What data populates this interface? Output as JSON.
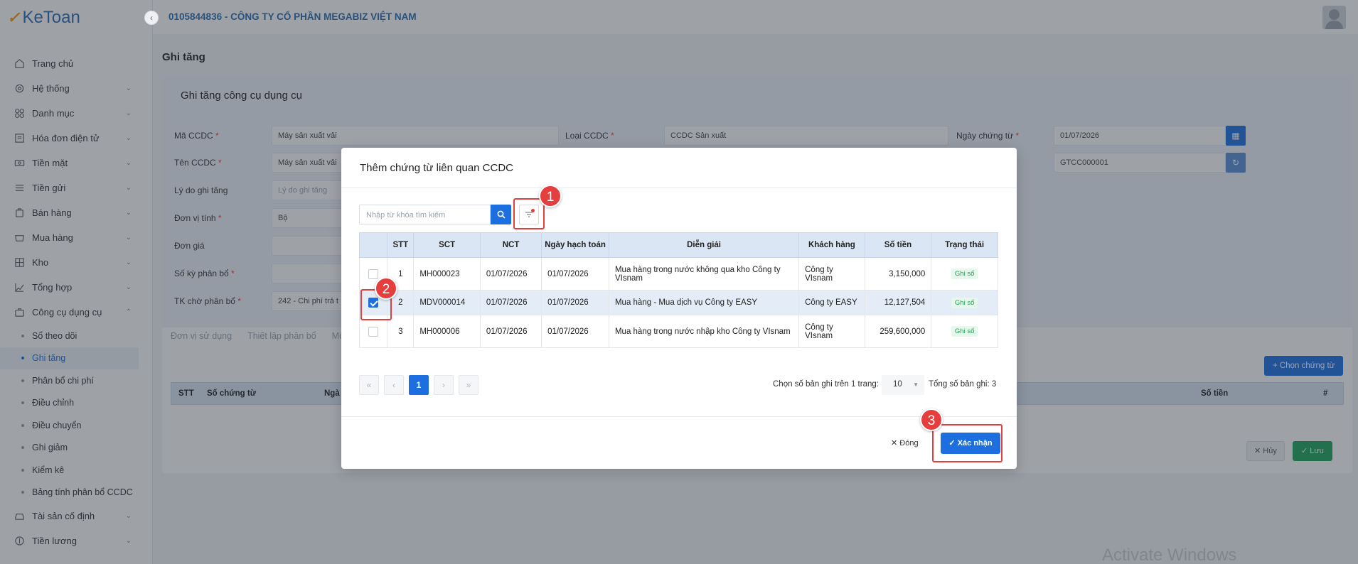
{
  "app": {
    "logo_text": "KeToan"
  },
  "topbar": {
    "company": "0105844836 - CÔNG TY CỔ PHẦN MEGABIZ VIỆT NAM"
  },
  "sidebar": {
    "items": [
      {
        "label": "Trang chủ",
        "icon": "home-icon"
      },
      {
        "label": "Hệ thống",
        "icon": "gear-icon"
      },
      {
        "label": "Danh mục",
        "icon": "grid-icon"
      },
      {
        "label": "Hóa đơn điện tử",
        "icon": "invoice-icon"
      },
      {
        "label": "Tiền mặt",
        "icon": "cash-icon"
      },
      {
        "label": "Tiền gửi",
        "icon": "bank-icon"
      },
      {
        "label": "Bán hàng",
        "icon": "sales-icon"
      },
      {
        "label": "Mua hàng",
        "icon": "cart-icon"
      },
      {
        "label": "Kho",
        "icon": "warehouse-icon"
      },
      {
        "label": "Tổng hợp",
        "icon": "chart-icon"
      },
      {
        "label": "Công cụ dụng cụ",
        "icon": "tools-icon"
      }
    ],
    "subitems": [
      "Sổ theo dõi",
      "Ghi tăng",
      "Phân bổ chi phí",
      "Điều chỉnh",
      "Điều chuyển",
      "Ghi giảm",
      "Kiểm kê",
      "Bảng tính phân bổ CCDC"
    ],
    "bottom_items": [
      {
        "label": "Tài sản cố định",
        "icon": "car-icon"
      },
      {
        "label": "Tiền lương",
        "icon": "salary-icon"
      }
    ]
  },
  "page": {
    "title": "Ghi tăng",
    "card_title": "Ghi tăng công cụ dụng cụ",
    "fields": {
      "ma_ccdc_label": "Mã CCDC",
      "ma_ccdc_value": "Máy sản xuất vải",
      "ten_ccdc_label": "Tên CCDC",
      "ten_ccdc_value": "Máy sản xuất vải",
      "ly_do_label": "Lý do ghi tăng",
      "ly_do_placeholder": "Lý do ghi tăng",
      "don_vi_label": "Đơn vị tính",
      "don_vi_value": "Bộ",
      "don_gia_label": "Đơn giá",
      "so_ky_label": "Số kỳ phân bổ",
      "tk_label": "TK chờ phân bổ",
      "tk_value": "242 - Chi phí trả t",
      "loai_label": "Loại CCDC",
      "loai_value": "CCDC Sản xuất",
      "ngay_label": "Ngày chứng từ",
      "ngay_value": "01/07/2026",
      "so_ct_value": "GTCC000001"
    },
    "tabs": [
      "Đơn vị sử dụng",
      "Thiết lập phân bổ",
      "Mô"
    ],
    "choose_button": "Chọn chứng từ",
    "grid_headers": {
      "stt": "STT",
      "so_ct": "Số chứng từ",
      "ngay": "Ngà",
      "so_tien": "Số tiền",
      "hash": "#"
    },
    "cancel_button": "Hủy",
    "save_button": "Lưu"
  },
  "modal": {
    "title": "Thêm chứng từ liên quan CCDC",
    "search_placeholder": "Nhập từ khóa tìm kiếm",
    "columns": [
      "STT",
      "SCT",
      "NCT",
      "Ngày hạch toán",
      "Diễn giải",
      "Khách hàng",
      "Số tiền",
      "Trạng thái"
    ],
    "rows": [
      {
        "checked": false,
        "stt": "1",
        "sct": "MH000023",
        "nct": "01/07/2026",
        "ngay_hach_toan": "01/07/2026",
        "dien_giai": "Mua hàng trong nước không qua kho Công ty VIsnam",
        "khach_hang": "Công ty VIsnam",
        "so_tien": "3,150,000",
        "trang_thai": "Ghi sổ"
      },
      {
        "checked": true,
        "stt": "2",
        "sct": "MDV000014",
        "nct": "01/07/2026",
        "ngay_hach_toan": "01/07/2026",
        "dien_giai": "Mua hàng - Mua dịch vụ Công ty EASY",
        "khach_hang": "Công ty EASY",
        "so_tien": "12,127,504",
        "trang_thai": "Ghi sổ"
      },
      {
        "checked": false,
        "stt": "3",
        "sct": "MH000006",
        "nct": "01/07/2026",
        "ngay_hach_toan": "01/07/2026",
        "dien_giai": "Mua hàng trong nước nhập kho Công ty VIsnam",
        "khach_hang": "Công ty VIsnam",
        "so_tien": "259,600,000",
        "trang_thai": "Ghi sổ"
      }
    ],
    "pagination": {
      "first": "«",
      "prev": "‹",
      "current": "1",
      "next": "›",
      "last": "»"
    },
    "per_page_label": "Chọn số bản ghi trên 1 trang:",
    "per_page_value": "10",
    "total_label": "Tổng số bản ghi:  3",
    "close_button": "Đóng",
    "confirm_button": "Xác nhận"
  },
  "markers": [
    "1",
    "2",
    "3"
  ],
  "watermark": "Activate Windows",
  "colors": {
    "primary": "#1d6fe0",
    "success": "#1fa75a",
    "danger": "#e53e3e",
    "header_bg": "#dbe6f5"
  }
}
